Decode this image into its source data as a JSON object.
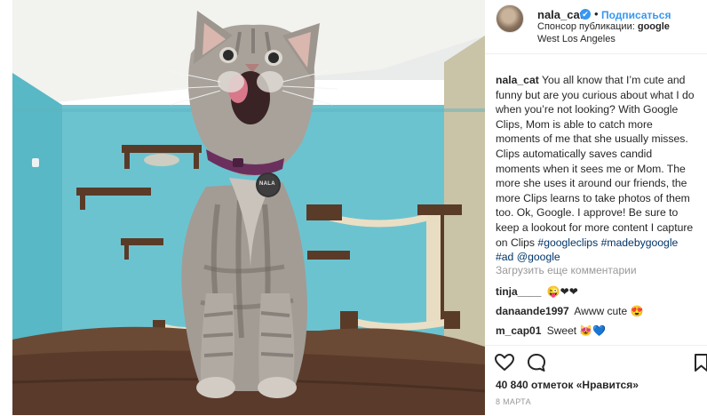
{
  "post": {
    "username": "nala_cat",
    "verified_mark": "✔",
    "separator": "•",
    "follow_label": "Подписаться",
    "sponsor_prefix": "Спонсор публикации:",
    "sponsor_name": "google",
    "location": "West Los Angeles"
  },
  "photo": {
    "collar_tag_text": "NALA",
    "wall_color": "#6cc3d0",
    "floor_color": "#6b4a35"
  },
  "caption": {
    "username": "nala_cat",
    "text": "You all know that I’m cute and funny but are you curious about what I do when you’re not looking? With Google Clips, Mom is able to catch more moments of me that she usually misses. Clips automatically saves candid moments when it sees me or Mom. The more she uses it around our friends, the more Clips learns to take photos of them too. Ok, Google. I approve! Be sure to keep a lookout for more content I capture on Clips",
    "hashtags": "#googleclips #madebygoogle #ad",
    "mention": "@google"
  },
  "load_more_label": "Загрузить еще комментарии",
  "comments": [
    {
      "username": "tinja____",
      "text": "😜❤❤"
    },
    {
      "username": "danaande1997",
      "text": "Awww cute 😍"
    },
    {
      "username": "m_cap01",
      "text": "Sweet 😻💙"
    }
  ],
  "actions": {
    "like_icon": "heart-icon",
    "comment_icon": "comment-bubble-icon",
    "save_icon": "bookmark-icon"
  },
  "likes_label": "40 840 отметок «Нравится»",
  "date_label": "8 МАРТА"
}
